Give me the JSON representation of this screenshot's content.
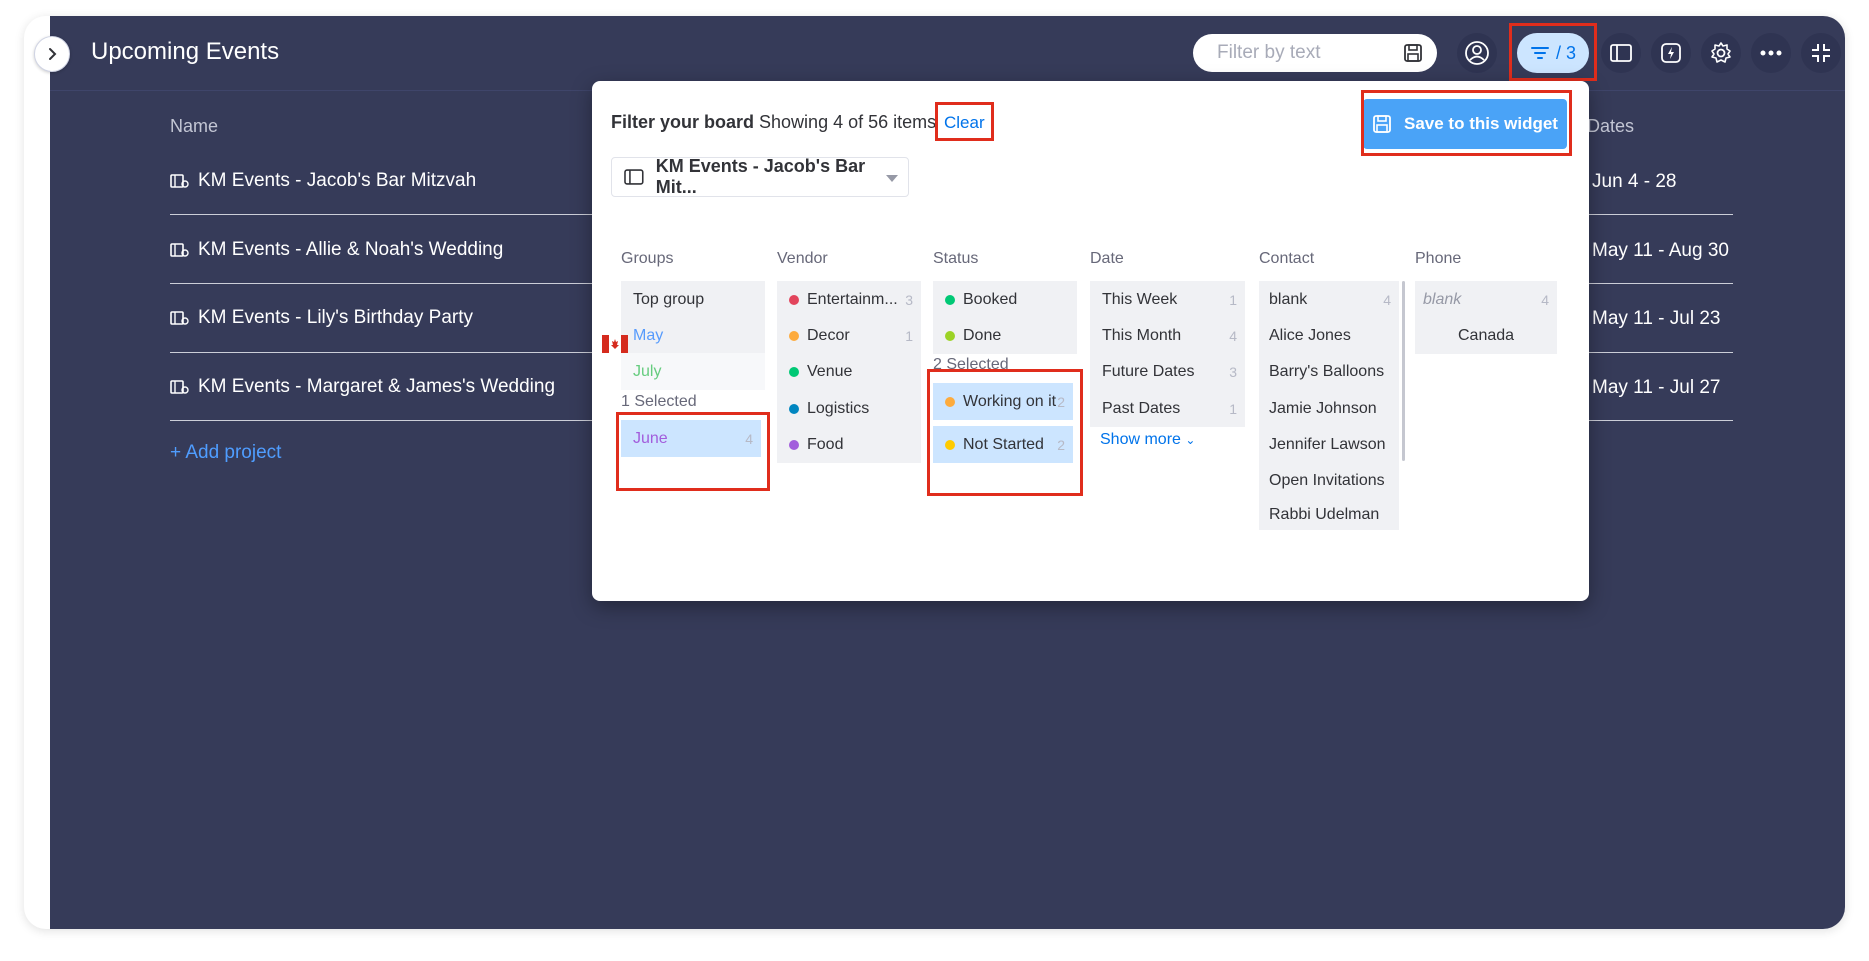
{
  "header": {
    "title": "Upcoming Events",
    "filter_placeholder": "Filter by text",
    "filter_count": "/ 3"
  },
  "table": {
    "columns": [
      "Name",
      "Dates"
    ],
    "rows": [
      {
        "name": "KM Events - Jacob's Bar Mitzvah",
        "dates": "Jun 4 - 28"
      },
      {
        "name": "KM Events - Allie & Noah's Wedding",
        "dates": "May 11 - Aug 30"
      },
      {
        "name": "KM Events - Lily's Birthday Party",
        "dates": "May 11 - Jul 23"
      },
      {
        "name": "KM Events - Margaret & James's Wedding",
        "dates": "May 11 - Jul 27"
      }
    ],
    "add_project": "+ Add project"
  },
  "filter_panel": {
    "title": "Filter your board",
    "showing": "Showing 4 of 56 items",
    "clear": "Clear",
    "save_button": "Save to this widget",
    "board_select": "KM Events - Jacob's Bar Mit...",
    "groups": {
      "header": "Groups",
      "items": [
        {
          "label": "Top group",
          "color": "#323338"
        },
        {
          "label": "May",
          "color": "#579bfc"
        },
        {
          "label": "July",
          "color": "#66cc7f"
        }
      ],
      "selected_label": "1 Selected",
      "selected": [
        {
          "label": "June",
          "count": "4",
          "color": "#a25ddc"
        }
      ]
    },
    "vendor": {
      "header": "Vendor",
      "items": [
        {
          "label": "Entertainm...",
          "count": "3",
          "dot": "#e2445c"
        },
        {
          "label": "Decor",
          "count": "1",
          "dot": "#fdab3d"
        },
        {
          "label": "Venue",
          "count": "",
          "dot": "#00c875"
        },
        {
          "label": "Logistics",
          "count": "",
          "dot": "#0086c0"
        },
        {
          "label": "Food",
          "count": "",
          "dot": "#a25ddc"
        }
      ]
    },
    "status": {
      "header": "Status",
      "items": [
        {
          "label": "Booked",
          "dot": "#00c875"
        },
        {
          "label": "Done",
          "dot": "#9cd326"
        }
      ],
      "selected_label": "2 Selected",
      "selected": [
        {
          "label": "Working on it",
          "count": "2",
          "dot": "#fdab3d"
        },
        {
          "label": "Not Started",
          "count": "2",
          "dot": "#ffcb00"
        }
      ]
    },
    "date": {
      "header": "Date",
      "items": [
        {
          "label": "This Week",
          "count": "1"
        },
        {
          "label": "This Month",
          "count": "4"
        },
        {
          "label": "Future Dates",
          "count": "3"
        },
        {
          "label": "Past Dates",
          "count": "1"
        }
      ],
      "show_more": "Show more"
    },
    "contact": {
      "header": "Contact",
      "items": [
        {
          "label": "blank",
          "count": "4"
        },
        {
          "label": "Alice Jones",
          "count": ""
        },
        {
          "label": "Barry's Balloons",
          "count": ""
        },
        {
          "label": "Jamie Johnson",
          "count": ""
        },
        {
          "label": "Jennifer Lawson",
          "count": ""
        },
        {
          "label": "Open Invitations",
          "count": ""
        },
        {
          "label": "Rabbi Udelman",
          "count": ""
        }
      ]
    },
    "phone": {
      "header": "Phone",
      "items": [
        {
          "label": "blank",
          "count": "4"
        },
        {
          "label": "Canada",
          "count": ""
        }
      ]
    }
  },
  "colors": {
    "board_bg": "#363b59",
    "accent": "#0073ea",
    "highlight": "#e02d1c"
  }
}
